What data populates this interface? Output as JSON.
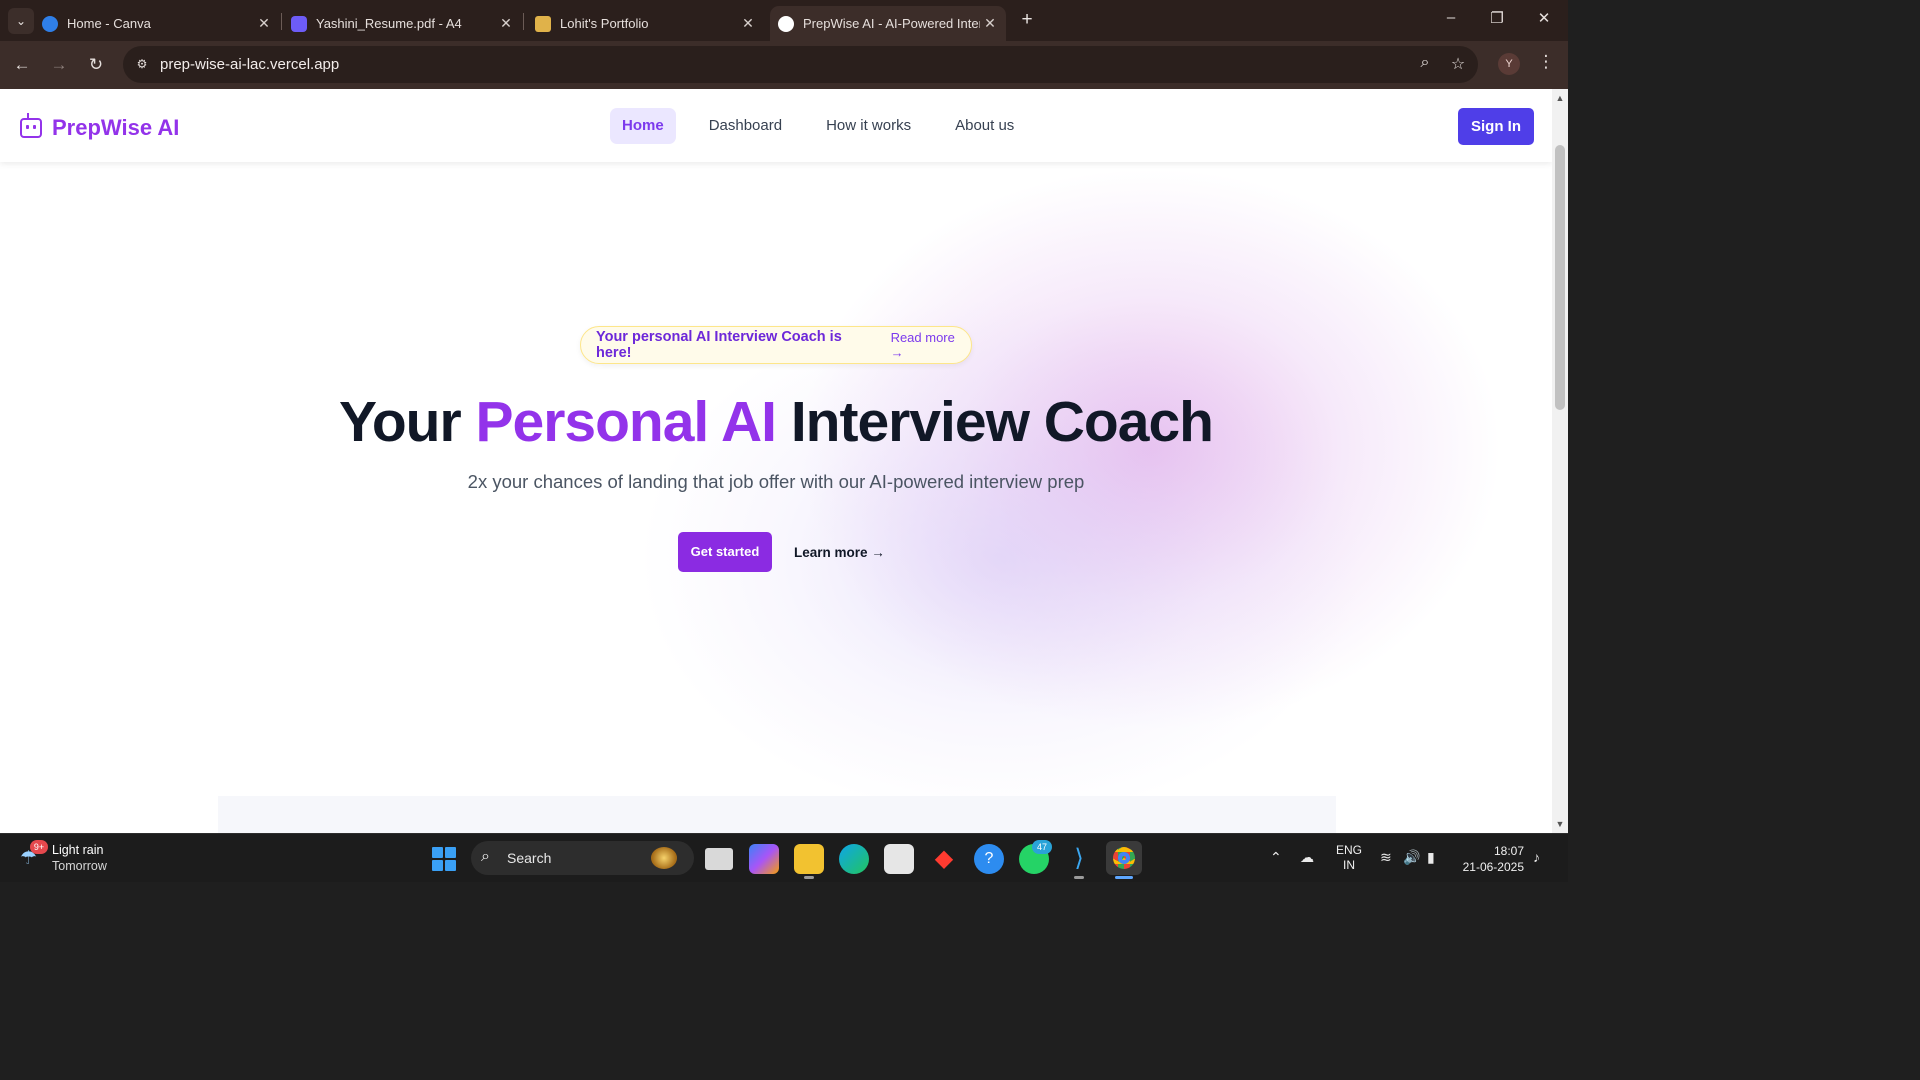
{
  "browser": {
    "tabs": [
      {
        "title": "Home - Canva",
        "favicon": "canva-icon",
        "color": "#3b8cf0"
      },
      {
        "title": "Yashini_Resume.pdf - A4",
        "favicon": "canva-doc-icon",
        "color": "#7b5cff"
      },
      {
        "title": "Lohit's Portfolio",
        "favicon": "portfolio-icon",
        "color": "#e4b33b"
      },
      {
        "title": "PrepWise AI - AI-Powered Inter",
        "favicon": "prepwise-icon",
        "color": "#ffffff",
        "active": true
      }
    ],
    "url": "prep-wise-ai-lac.vercel.app",
    "profile_initial": "Y"
  },
  "site": {
    "brand": "PrepWise AI",
    "nav": [
      "Home",
      "Dashboard",
      "How it works",
      "About us"
    ],
    "active_nav": "Home",
    "sign_in": "Sign In",
    "announcement": {
      "text": "Your personal AI Interview Coach is here!",
      "link": "Read more →"
    },
    "hero": {
      "title_start": "Your",
      "title_highlight": "Personal AI",
      "title_end": "Interview Coach",
      "subtitle": "2x your chances of landing that job offer with our AI-powered interview prep",
      "cta_primary": "Get started",
      "cta_secondary": "Learn more →"
    },
    "colors": {
      "brand": "#9333ea",
      "signin": "#4f3ee8",
      "highlight": "#fde68a"
    }
  },
  "taskbar": {
    "weather": {
      "condition": "Light rain",
      "when": "Tomorrow",
      "badge": "9+"
    },
    "search_placeholder": "Search",
    "whatsapp_badge": "47",
    "language": {
      "line1": "ENG",
      "line2": "IN"
    },
    "time": "18:07",
    "date": "21-06-2025"
  }
}
